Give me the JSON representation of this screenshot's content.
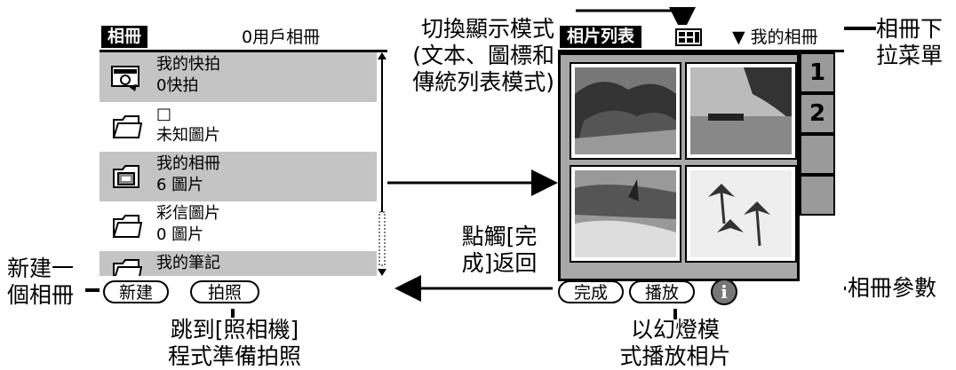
{
  "left_screen": {
    "title": "相冊",
    "album_label": "0用戶相冊",
    "albums": [
      {
        "name": "我的快拍",
        "count": "0快拍",
        "icon": "camera-folder-icon"
      },
      {
        "name": "□",
        "count": "未知圖片",
        "icon": "folder-icon"
      },
      {
        "name": "我的相冊",
        "count": "6 圖片",
        "icon": "photo-folder-icon"
      },
      {
        "name": "彩信圖片",
        "count": "0 圖片",
        "icon": "folder-icon"
      },
      {
        "name": "我的筆記",
        "count": "",
        "icon": "folder-icon"
      }
    ],
    "buttons": {
      "new": "新建",
      "capture": "拍照"
    }
  },
  "right_screen": {
    "title": "相片列表",
    "mode_icon": "grid-view-icon",
    "dropdown_label": "我的相冊",
    "page_tabs": [
      "1",
      "2",
      "",
      ""
    ],
    "buttons": {
      "done": "完成",
      "play": "播放"
    },
    "info_icon": "i"
  },
  "callouts": {
    "new_album": [
      "新建一",
      "個相冊"
    ],
    "capture": [
      "跳到[照相機]",
      "程式準備拍照"
    ],
    "switch_mode": [
      "切換顯示模式",
      "(文本、圖標和",
      "傳統列表模式)"
    ],
    "dropdown": [
      "相冊下",
      "拉菜單"
    ],
    "done": [
      "點觸[完",
      "成]返回"
    ],
    "params": "相冊參數",
    "slideshow": [
      "以幻燈模",
      "式播放相片"
    ]
  }
}
